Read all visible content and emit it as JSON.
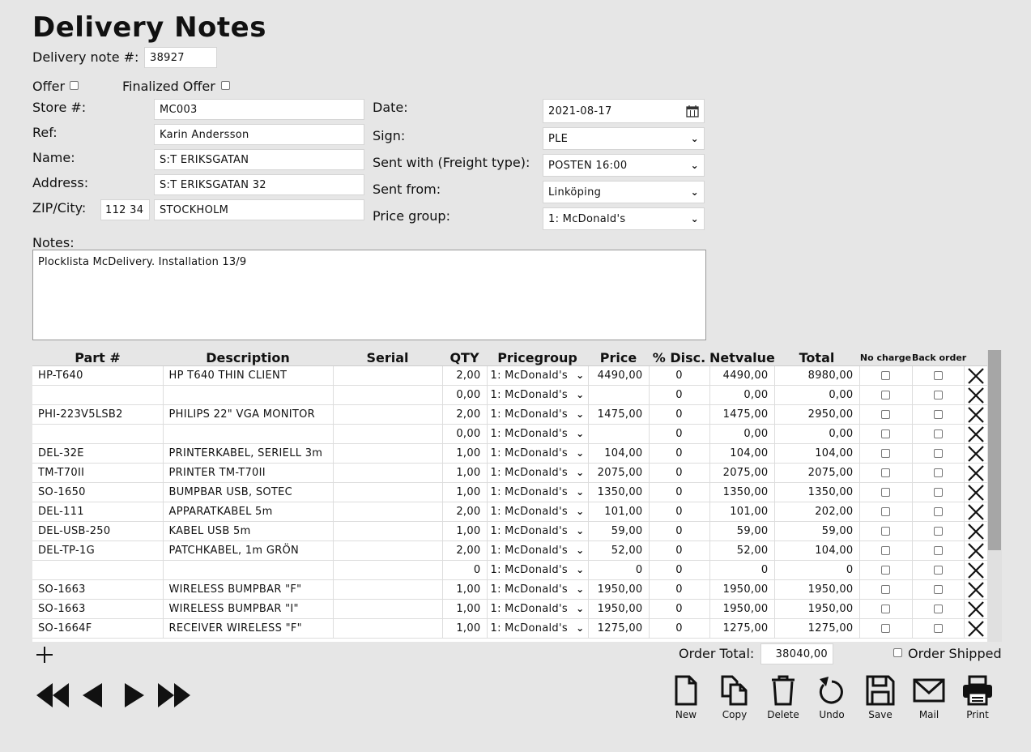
{
  "title": "Delivery Notes",
  "delivery_note": {
    "label": "Delivery note #:",
    "value": "38927"
  },
  "offer": {
    "label": "Offer",
    "checked": false
  },
  "finalized_offer": {
    "label": "Finalized Offer",
    "checked": false
  },
  "left_fields": {
    "store": {
      "label": "Store #:",
      "value": "MC003"
    },
    "ref": {
      "label": "Ref:",
      "value": "Karin Andersson"
    },
    "name": {
      "label": "Name:",
      "value": "S:T ERIKSGATAN"
    },
    "address": {
      "label": "Address:",
      "value": "S:T ERIKSGATAN 32"
    },
    "zipcity": {
      "label": "ZIP/City:",
      "zip": "112 34",
      "city": "STOCKHOLM"
    }
  },
  "right_fields": {
    "date": {
      "label": "Date:",
      "value": "2021-08-17"
    },
    "sign": {
      "label": "Sign:",
      "value": "PLE"
    },
    "freight": {
      "label": "Sent with (Freight type):",
      "value": "POSTEN 16:00"
    },
    "sent_from": {
      "label": "Sent from:",
      "value": "Linköping"
    },
    "price_group": {
      "label": "Price group:",
      "value": "1: McDonald's"
    }
  },
  "notes": {
    "label": "Notes:",
    "value": "Plocklista McDelivery. Installation 13/9"
  },
  "table": {
    "headers": [
      "Part #",
      "Description",
      "Serial",
      "QTY",
      "Pricegroup",
      "Price",
      "% Disc.",
      "Netvalue",
      "Total",
      "No charge",
      "Back order"
    ],
    "rows": [
      {
        "part": "HP-T640",
        "desc": "HP T640 THIN CLIENT",
        "serial": "",
        "qty": "2,00",
        "pg": "1: McDonald's",
        "price": "4490,00",
        "disc": "0",
        "net": "4490,00",
        "total": "8980,00"
      },
      {
        "part": "",
        "desc": "",
        "serial": "",
        "qty": "0,00",
        "pg": "1: McDonald's",
        "price": "",
        "disc": "0",
        "net": "0,00",
        "total": "0,00"
      },
      {
        "part": "PHI-223V5LSB2",
        "desc": "PHILIPS 22\" VGA MONITOR",
        "serial": "",
        "qty": "2,00",
        "pg": "1: McDonald's",
        "price": "1475,00",
        "disc": "0",
        "net": "1475,00",
        "total": "2950,00"
      },
      {
        "part": "",
        "desc": "",
        "serial": "",
        "qty": "0,00",
        "pg": "1: McDonald's",
        "price": "",
        "disc": "0",
        "net": "0,00",
        "total": "0,00"
      },
      {
        "part": "DEL-32E",
        "desc": "PRINTERKABEL, SERIELL 3m",
        "serial": "",
        "qty": "1,00",
        "pg": "1: McDonald's",
        "price": "104,00",
        "disc": "0",
        "net": "104,00",
        "total": "104,00"
      },
      {
        "part": "TM-T70II",
        "desc": "PRINTER TM-T70II",
        "serial": "",
        "qty": "1,00",
        "pg": "1: McDonald's",
        "price": "2075,00",
        "disc": "0",
        "net": "2075,00",
        "total": "2075,00"
      },
      {
        "part": "SO-1650",
        "desc": "BUMPBAR USB, SOTEC",
        "serial": "",
        "qty": "1,00",
        "pg": "1: McDonald's",
        "price": "1350,00",
        "disc": "0",
        "net": "1350,00",
        "total": "1350,00"
      },
      {
        "part": "DEL-111",
        "desc": "APPARATKABEL 5m",
        "serial": "",
        "qty": "2,00",
        "pg": "1: McDonald's",
        "price": "101,00",
        "disc": "0",
        "net": "101,00",
        "total": "202,00"
      },
      {
        "part": "DEL-USB-250",
        "desc": "KABEL USB 5m",
        "serial": "",
        "qty": "1,00",
        "pg": "1: McDonald's",
        "price": "59,00",
        "disc": "0",
        "net": "59,00",
        "total": "59,00"
      },
      {
        "part": "DEL-TP-1G",
        "desc": "PATCHKABEL, 1m GRÖN",
        "serial": "",
        "qty": "2,00",
        "pg": "1: McDonald's",
        "price": "52,00",
        "disc": "0",
        "net": "52,00",
        "total": "104,00"
      },
      {
        "part": "",
        "desc": "",
        "serial": "",
        "qty": "0",
        "pg": "1: McDonald's",
        "price": "0",
        "disc": "0",
        "net": "0",
        "total": "0"
      },
      {
        "part": "SO-1663",
        "desc": "WIRELESS BUMPBAR \"F\"",
        "serial": "",
        "qty": "1,00",
        "pg": "1: McDonald's",
        "price": "1950,00",
        "disc": "0",
        "net": "1950,00",
        "total": "1950,00"
      },
      {
        "part": "SO-1663",
        "desc": "WIRELESS BUMPBAR \"I\"",
        "serial": "",
        "qty": "1,00",
        "pg": "1: McDonald's",
        "price": "1950,00",
        "disc": "0",
        "net": "1950,00",
        "total": "1950,00"
      },
      {
        "part": "SO-1664F",
        "desc": "RECEIVER WIRELESS \"F\"",
        "serial": "",
        "qty": "1,00",
        "pg": "1: McDonald's",
        "price": "1275,00",
        "disc": "0",
        "net": "1275,00",
        "total": "1275,00"
      }
    ]
  },
  "order_total": {
    "label": "Order Total:",
    "value": "38040,00"
  },
  "order_shipped": {
    "label": "Order Shipped",
    "checked": false
  },
  "toolbar": {
    "new": "New",
    "copy": "Copy",
    "delete": "Delete",
    "undo": "Undo",
    "save": "Save",
    "mail": "Mail",
    "print": "Print"
  },
  "icons": {
    "add": "plus-icon",
    "first": "first-record-icon",
    "prev": "previous-record-icon",
    "next": "next-record-icon",
    "last": "last-record-icon",
    "remove_row": "x-icon",
    "calendar": "calendar-icon"
  }
}
